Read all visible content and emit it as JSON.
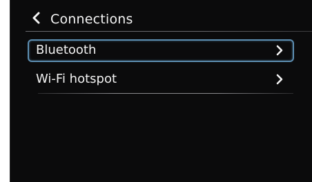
{
  "header": {
    "title": "Connections",
    "back_icon": "chevron-left-icon"
  },
  "menu": {
    "items": [
      {
        "label": "Bluetooth",
        "selected": true,
        "icon": "chevron-right-icon"
      },
      {
        "label": "Wi-Fi hotspot",
        "selected": false,
        "icon": "chevron-right-icon"
      }
    ]
  },
  "colors": {
    "background": "#0b0b0c",
    "text": "#f2f2f2",
    "selection_border": "#5d8fb3",
    "divider": "#6a6a6e"
  }
}
